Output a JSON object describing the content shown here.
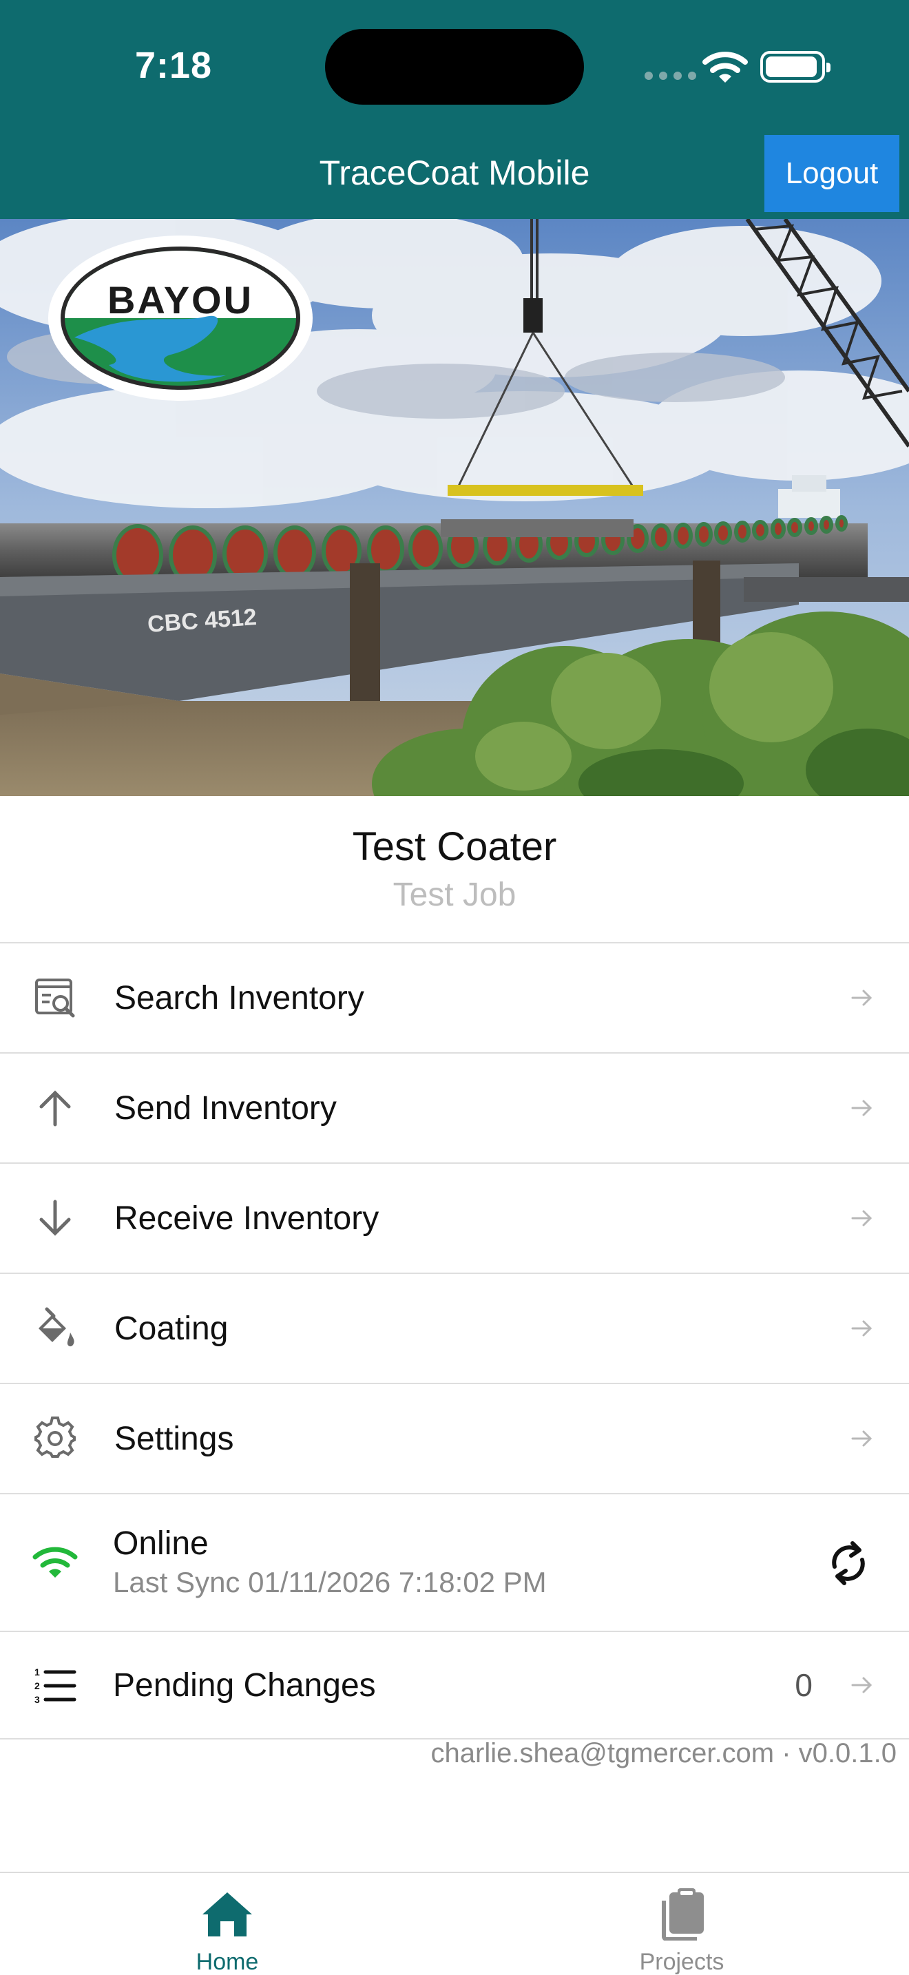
{
  "status_bar": {
    "time": "7:18"
  },
  "header": {
    "title": "TraceCoat Mobile",
    "logout_label": "Logout"
  },
  "hero": {
    "logo_text": "BAYOU",
    "barge_label": "CBC 4512"
  },
  "coater": {
    "name": "Test Coater",
    "job": "Test Job"
  },
  "menu": {
    "items": [
      {
        "label": "Search Inventory",
        "icon": "search-inventory-icon"
      },
      {
        "label": "Send Inventory",
        "icon": "arrow-up-icon"
      },
      {
        "label": "Receive Inventory",
        "icon": "arrow-down-icon"
      },
      {
        "label": "Coating",
        "icon": "paint-bucket-icon"
      },
      {
        "label": "Settings",
        "icon": "gear-icon"
      }
    ]
  },
  "connection": {
    "status": "Online",
    "last_sync": "Last Sync 01/11/2026 7:18:02 PM",
    "status_color": "#22b83a"
  },
  "pending": {
    "label": "Pending Changes",
    "count": "0"
  },
  "footer": {
    "note": "charlie.shea@tgmercer.com · v0.0.1.0"
  },
  "tabs": [
    {
      "label": "Home",
      "icon": "home-icon",
      "active": true
    },
    {
      "label": "Projects",
      "icon": "clipboard-icon",
      "active": false
    }
  ],
  "colors": {
    "header_bg": "#0e6b6e",
    "logout_bg": "#1f86e0",
    "tab_active": "#0e6b6e",
    "tab_inactive": "#8e8e8e"
  }
}
